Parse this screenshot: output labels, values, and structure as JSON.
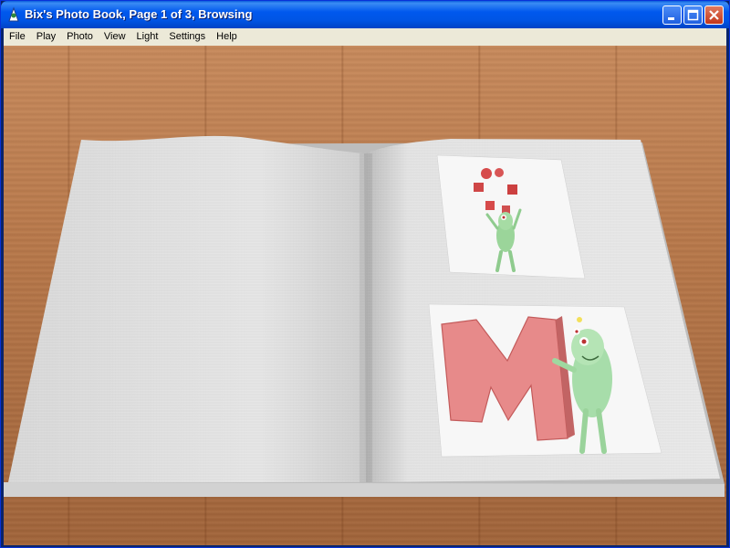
{
  "window": {
    "title": "Bix's Photo Book, Page 1 of 3, Browsing"
  },
  "menu": {
    "items": [
      "File",
      "Play",
      "Photo",
      "View",
      "Light",
      "Settings",
      "Help"
    ]
  },
  "book": {
    "photos": [
      {
        "subject": "green character juggling letters"
      },
      {
        "subject": "green character leaning on red letter M"
      }
    ]
  }
}
